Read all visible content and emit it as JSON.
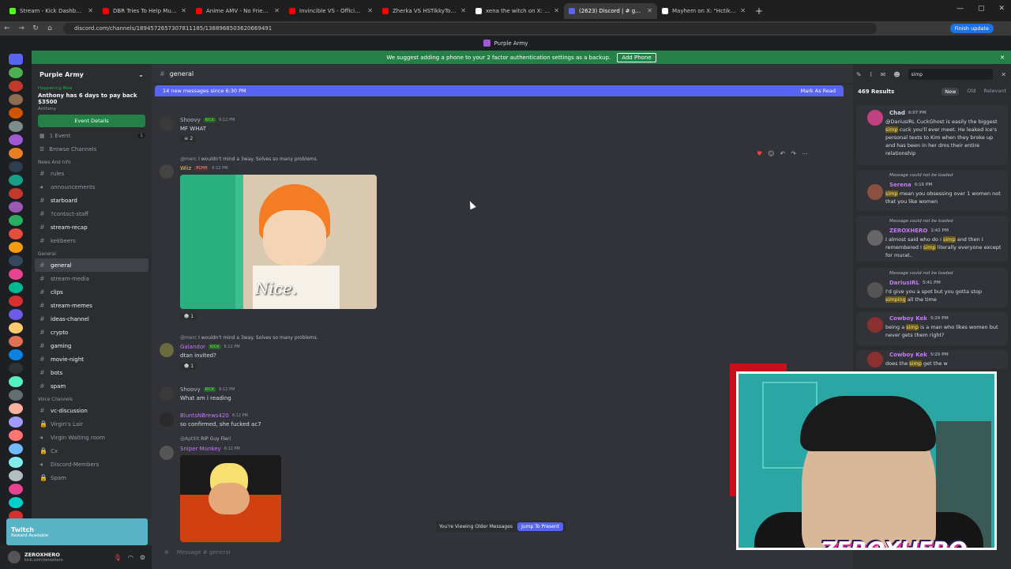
{
  "browser": {
    "tabs": [
      {
        "title": "Stream - Kick Dashboard",
        "color": "#53fc18"
      },
      {
        "title": "DBR Tries To Help Murat But E...",
        "color": "#ff0000"
      },
      {
        "title": "Anime AMV - No Friends In Th...",
        "color": "#ff0000"
      },
      {
        "title": "Invincible VS - Official Battle B...",
        "color": "#ff0000"
      },
      {
        "title": "Zherka VS HSTikkyTokky (Full C...",
        "color": "#ff0000"
      },
      {
        "title": "xena the witch on X: \"This bitch...",
        "color": "#ffffff"
      },
      {
        "title": "(2623) Discord | # general | P...",
        "color": "#5865f2"
      },
      {
        "title": "Mayhem on X: \"Hctikkytokky at...",
        "color": "#ffffff"
      }
    ],
    "url": "discord.com/channels/1894572657307811185/1388968503620669491",
    "finish_update": "Finish update"
  },
  "app": {
    "server_title": "Purple Army"
  },
  "banner": {
    "text": "We suggest adding a phone to your 2 factor authentication settings as a backup.",
    "button": "Add Phone"
  },
  "server": {
    "name": "Purple Army"
  },
  "event": {
    "happening": "Happening Now",
    "title": "Anthony has 6 days to pay back $3500",
    "author": "Anthony",
    "button": "Event Details"
  },
  "sidebar": {
    "events": "1 Event",
    "events_count": "1",
    "browse": "Browse Channels",
    "cat_news": "News and Info",
    "cat_general": "General",
    "cat_voice": "Voice Channels",
    "news": [
      "rules",
      "announcements",
      "starboard",
      "?contact-staff",
      "stream-recap",
      "kekbeers"
    ],
    "general": [
      "general",
      "stream-media",
      "clips",
      "stream-memes",
      "ideas-channel",
      "crypto",
      "gaming",
      "movie-night",
      "bots",
      "spam"
    ],
    "voice": [
      "vc-discussion",
      "Virgin's Lair",
      "Virgin Waiting room",
      "Cx",
      "Discord-Members",
      "Spam"
    ]
  },
  "promo": {
    "title": "Twitch",
    "sub": "Reward Available"
  },
  "user": {
    "name": "ZEROXHERO",
    "tag": "kick.com/zeroxhero"
  },
  "channel": {
    "name": "general"
  },
  "newbar": {
    "text": "14 new messages since 6:30 PM",
    "action": "Mark As Read"
  },
  "messages": [
    {
      "author": "Shoovy",
      "badge": "KICK",
      "time": "6:12 PM",
      "text": "MF WHAT",
      "reaction": "2"
    },
    {
      "reply_user": "@merc",
      "reply_text": "I wouldn't mind a 3way. Solves so many problems.",
      "author": "Wiiz",
      "badge": "PCHH",
      "time": "6:12 PM",
      "image_caption": "Nice.",
      "reaction": "1"
    },
    {
      "reply_user": "@merc",
      "reply_text": "I wouldn't mind a 3way. Solves so many problems.",
      "author": "Galandor",
      "badge": "KICK",
      "time": "6:12 PM",
      "text": "dtan invited?",
      "reaction": "1"
    },
    {
      "author": "Shoovy",
      "badge": "KICK",
      "time": "6:12 PM",
      "text": "What am i reading"
    },
    {
      "author": "BluntsNBrews420",
      "time": "6:12 PM",
      "text": "so confirmed, she fucked ac7"
    },
    {
      "reply_user": "@Aptitit",
      "reply_text": "RIP Guy Fieri",
      "author": "Sniper Monkey",
      "time": "6:12 PM"
    }
  ],
  "older": {
    "text": "You're Viewing Older Messages",
    "button": "Jump To Present"
  },
  "compose": {
    "placeholder": "Message # general"
  },
  "search": {
    "query": "simp",
    "results": "469 Results",
    "sort_new": "New",
    "sort_old": "Old",
    "sort_relevant": "Relevant",
    "not_loaded": "Message could not be loaded",
    "items": [
      {
        "author": "Chad",
        "time": "6:07 PM",
        "pre": "@DariusIRL CuckGhost is easily the biggest ",
        "hit": "simp",
        "post": " cuck you'll ever meet. He leaked Ice's personal texts to Kim when they broke up and has been in her dms their entire relationship"
      },
      {
        "author": "Serena",
        "time": "6:16 PM",
        "pre": "",
        "hit": "simp",
        "post": " mean you obsessing over 1 women not that you like women"
      },
      {
        "author": "ZEROXHERO",
        "time": "1:42 PM",
        "pre": "I almost said who do i ",
        "hit": "simp",
        "mid": " and then I remembered I ",
        "hit2": "simp",
        "post": " literally everyone except for murat.."
      },
      {
        "author": "DariusIRL",
        "time": "5:41 PM",
        "pre": "I'd give you a spot but you gotta stop ",
        "hit": "simping",
        "post": " all the time"
      },
      {
        "author": "Cowboy Kek",
        "time": "5:29 PM",
        "pre": "being a ",
        "hit": "simp",
        "post": " is a man who likes women but never gets them right?"
      },
      {
        "author": "Cowboy Kek",
        "time": "5:29 PM",
        "pre": "does the ",
        "hit": "simp",
        "post": " get the w"
      }
    ]
  },
  "overlay": {
    "logo": "ZEROXHERO"
  },
  "colors": {
    "accent": "#5865f2",
    "green": "#248046",
    "kick": "#53fc18"
  }
}
